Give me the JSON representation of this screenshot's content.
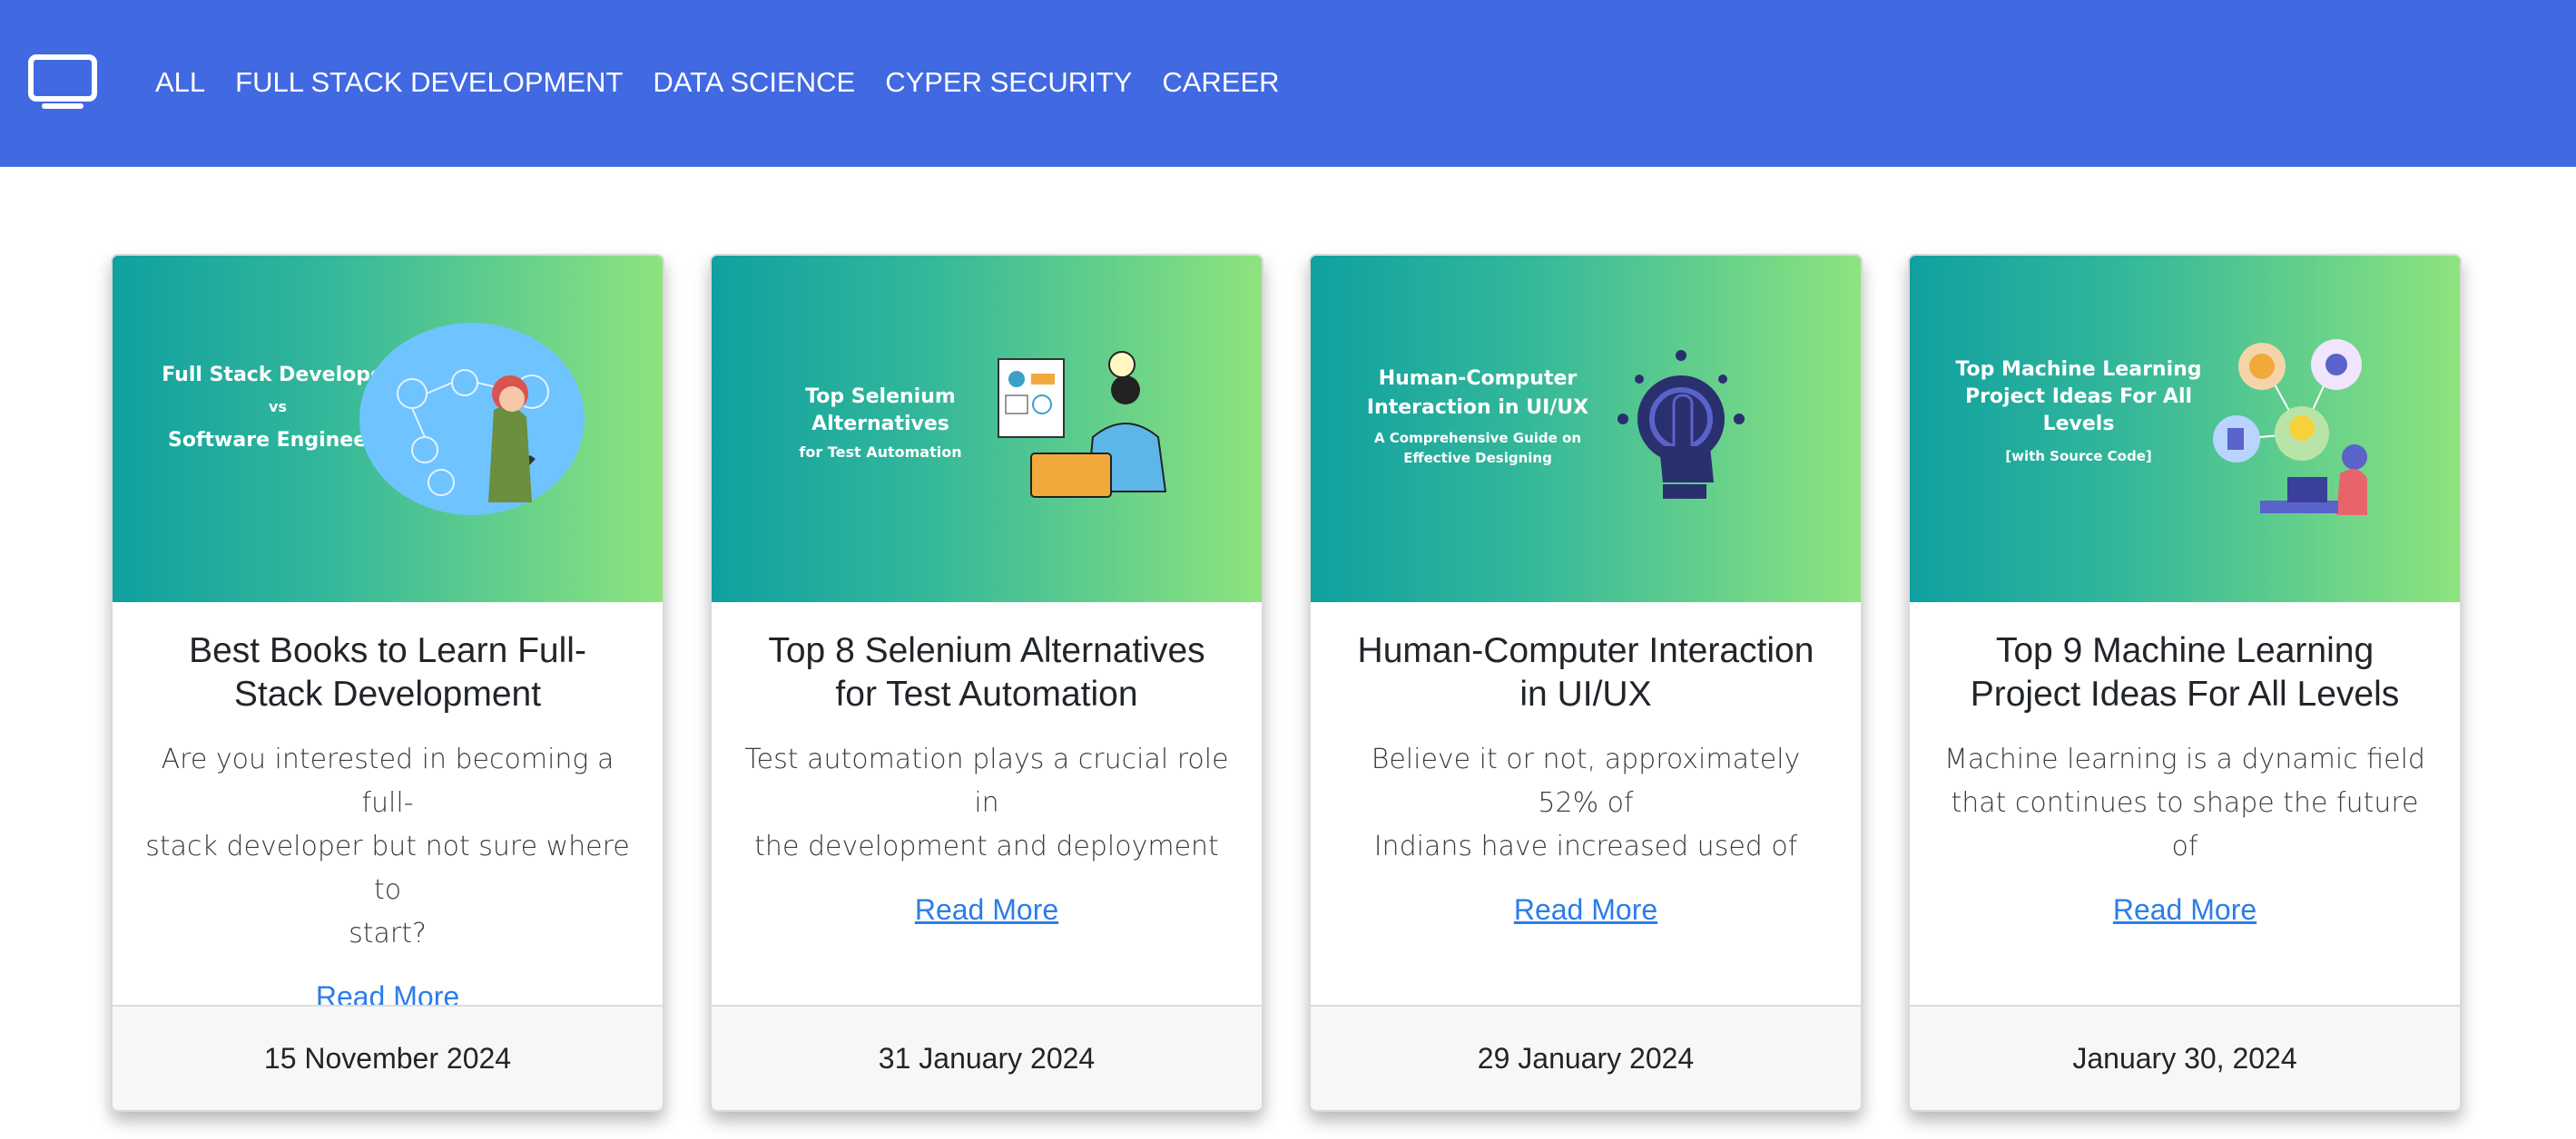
{
  "nav": {
    "brand_icon": "laptop-icon",
    "links": [
      "ALL",
      "FULL STACK DEVELOPMENT",
      "DATA SCIENCE",
      "CYPER SECURITY",
      "CAREER"
    ]
  },
  "colors": {
    "navbar": "#4169e1",
    "link": "#2b7de9",
    "gradient_start": "#0fa0a0",
    "gradient_end": "#8ee47e"
  },
  "cards": [
    {
      "image": {
        "line1": "Full Stack Developer",
        "line2": "vs",
        "line3": "Software Engineer"
      },
      "title_line1": "Best Books to Learn Full-",
      "title_line2": "Stack Development",
      "text_line1": "Are you interested in becoming a full-",
      "text_line2": "stack developer but not sure where to",
      "text_line3": "start?",
      "link": "Read More",
      "date": "15 November 2024"
    },
    {
      "image": {
        "line1": "Top Selenium",
        "line2": "Alternatives",
        "line3": "for Test Automation"
      },
      "title_line1": "Top 8 Selenium Alternatives",
      "title_line2": "for Test Automation",
      "text_line1": "Test automation plays a crucial role in",
      "text_line2": "the development and deployment",
      "link": "Read More",
      "date": "31 January 2024"
    },
    {
      "image": {
        "line1": "Human-Computer",
        "line2": "Interaction in UI/UX",
        "line3": "A Comprehensive Guide on",
        "line4": "Effective Designing"
      },
      "title_line1": "Human-Computer Interaction",
      "title_line2": "in UI/UX",
      "text_line1": "Believe it or not, approximately 52% of",
      "text_line2": "Indians have increased used of",
      "link": "Read More",
      "date": "29 January 2024"
    },
    {
      "image": {
        "line1": "Top Machine Learning",
        "line2": "Project Ideas For All",
        "line3": "Levels",
        "line4": "[with Source Code]"
      },
      "title_line1": "Top 9 Machine Learning",
      "title_line2": "Project Ideas For All Levels",
      "text_line1": "Machine learning is a dynamic field",
      "text_line2": "that continues to shape the future of",
      "link": "Read More",
      "date": "January 30, 2024"
    }
  ]
}
